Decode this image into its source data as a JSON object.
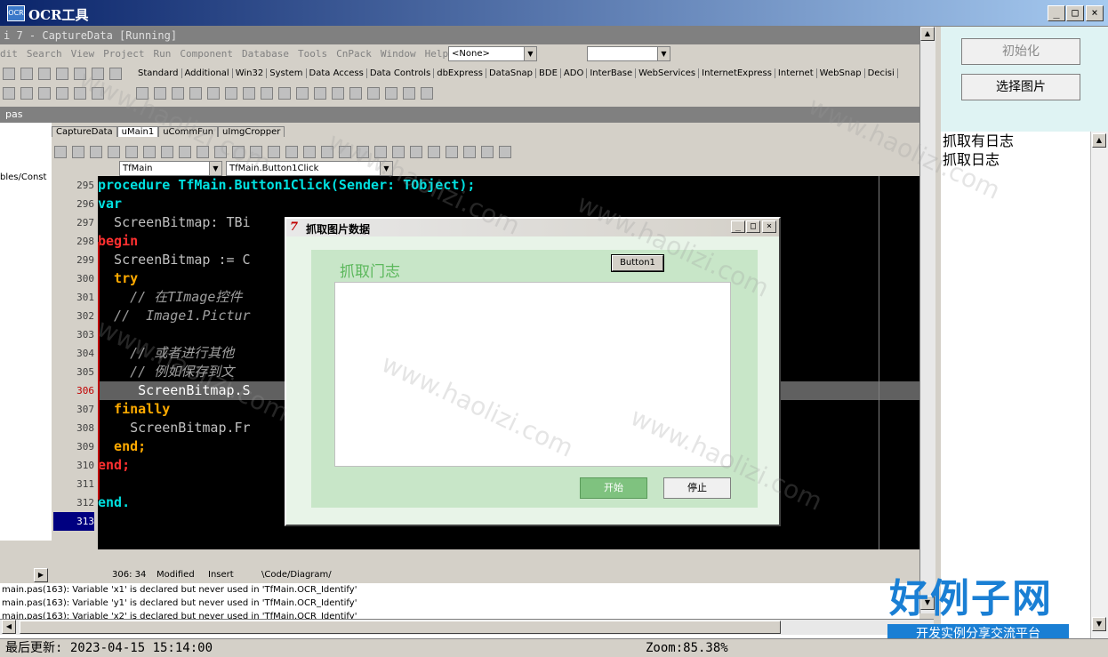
{
  "window": {
    "title": "OCR工具",
    "icon": "app-icon"
  },
  "ide": {
    "title": "i 7 - CaptureData [Running]",
    "menu": [
      "dit",
      "Search",
      "View",
      "Project",
      "Run",
      "Component",
      "Database",
      "Tools",
      "CnPack",
      "Window",
      "Help"
    ],
    "combo_none": "<None>",
    "palette_tabs": [
      "Standard",
      "Additional",
      "Win32",
      "System",
      "Data Access",
      "Data Controls",
      "dbExpress",
      "DataSnap",
      "BDE",
      "ADO",
      "InterBase",
      "WebServices",
      "InternetExpress",
      "Internet",
      "WebSnap",
      "Decisi"
    ],
    "pas_label": "pas",
    "left_tree_text": "bles/Const",
    "editor_tabs": [
      "CaptureData",
      "uMain1",
      "uCommFun",
      "uImgCropper"
    ],
    "form_combo": "TfMain",
    "method_combo": "TfMain.Button1Click",
    "lines": [
      {
        "n": "295",
        "text": "procedure TfMain.Button1Click(Sender: TObject);"
      },
      {
        "n": "296",
        "text": "var"
      },
      {
        "n": "297",
        "text": "  ScreenBitmap: TBi"
      },
      {
        "n": "298",
        "text": "begin"
      },
      {
        "n": "299",
        "text": "  ScreenBitmap := C"
      },
      {
        "n": "300",
        "text": "  try"
      },
      {
        "n": "301",
        "text": "    // 在TImage控件"
      },
      {
        "n": "302",
        "text": "  //  Image1.Pictur"
      },
      {
        "n": "303",
        "text": ""
      },
      {
        "n": "304",
        "text": "    // 或者进行其他"
      },
      {
        "n": "305",
        "text": "    // 例如保存到文"
      },
      {
        "n": "306",
        "text": "     ScreenBitmap.S"
      },
      {
        "n": "307",
        "text": "  finally"
      },
      {
        "n": "308",
        "text": "    ScreenBitmap.Fr"
      },
      {
        "n": "309",
        "text": "  end;"
      },
      {
        "n": "310",
        "text": "end;"
      },
      {
        "n": "311",
        "text": ""
      },
      {
        "n": "312",
        "text": "end."
      },
      {
        "n": "313",
        "text": ""
      }
    ],
    "status_pos": "306: 34",
    "status_modified": "Modified",
    "status_insert": "Insert",
    "status_tabs": "\\Code/Diagram/",
    "messages": [
      "main.pas(163): Variable 'x1' is declared but never used in 'TfMain.OCR_Identify'",
      "main.pas(163): Variable 'y1' is declared but never used in 'TfMain.OCR_Identify'",
      "main.pas(163): Variable 'x2' is declared but never used in 'TfMain.OCR_Identify'"
    ]
  },
  "dialog": {
    "title": "抓取图片数据",
    "caption": "抓取门志",
    "button1": "Button1",
    "start": "开始",
    "stop": "停止"
  },
  "right_panel": {
    "init_button": "初始化",
    "select_button": "选择图片",
    "log": [
      "抓取有日志",
      "抓取日志"
    ]
  },
  "status_bar": {
    "last_update": "最后更新: 2023-04-15 15:14:00",
    "zoom": "Zoom:85.38%"
  },
  "watermark": "www.haolizi.com",
  "logo": {
    "big": "好例子网",
    "small": "开发实例分享交流平台"
  },
  "colors": {
    "titlebar": "#0a246a",
    "code_bg": "#000000",
    "keyword": "#00e0e0",
    "dialog_panel": "#c8e6c8",
    "start_button": "#7fc27f",
    "logo": "#1a7fd4"
  }
}
